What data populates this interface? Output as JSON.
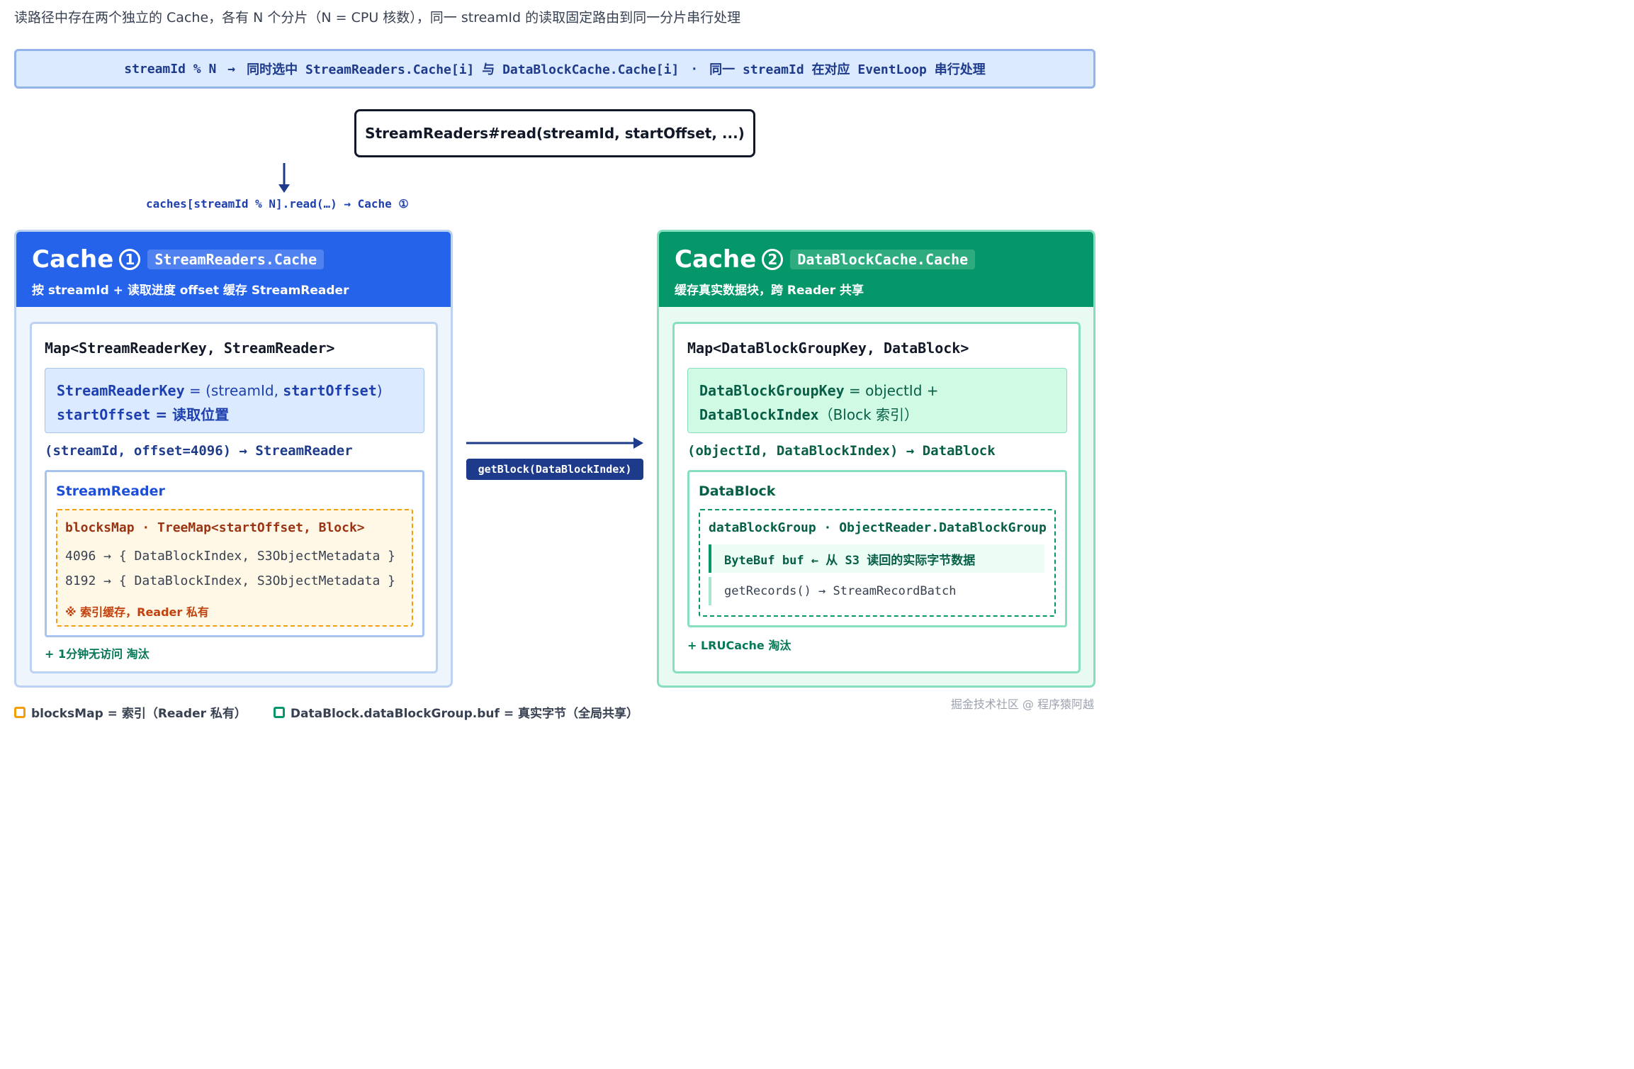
{
  "intro": "读路径中存在两个独立的 Cache，各有 N 个分片（N = CPU 核数），同一 streamId 的读取固定路由到同一分片串行处理",
  "banner": {
    "part1": "streamId % N",
    "arrow": "→",
    "part2": "同时选中 StreamReaders.Cache[i] 与 DataBlockCache.Cache[i]",
    "dot": "·",
    "part3": "同一 streamId 在对应 EventLoop 串行处理"
  },
  "entry": "StreamReaders#read(streamId, startOffset, ...)",
  "route_label": "caches[streamId % N].read(…) → Cache ①",
  "cache1": {
    "title": "Cache",
    "number": "1",
    "tag": "StreamReaders.Cache",
    "subtitle": "按 streamId + 读取进度 offset 缓存 StreamReader",
    "map_title": "Map<StreamReaderKey, StreamReader>",
    "key_line1_code": "StreamReaderKey",
    "key_line1_text": " = (streamId, ",
    "key_line1_code2": "startOffset",
    "key_line1_end": ")",
    "key_line2_code": "startOffset",
    "key_line2_text": " = 读取位置",
    "lookup": "(streamId, offset=4096) → StreamReader",
    "reader_title": "StreamReader",
    "blocks_head": "blocksMap · TreeMap<startOffset, Block>",
    "blocks_rows": [
      "4096 → { DataBlockIndex, S3ObjectMetadata }",
      "8192 → { DataBlockIndex, S3ObjectMetadata }"
    ],
    "blocks_note": "※ 索引缓存，Reader 私有",
    "evict": "+ 1分钟无访问 淘汰"
  },
  "cache2": {
    "title": "Cache",
    "number": "2",
    "tag": "DataBlockCache.Cache",
    "subtitle": "缓存真实数据块，跨 Reader 共享",
    "map_title": "Map<DataBlockGroupKey, DataBlock>",
    "key_line1_code": "DataBlockGroupKey",
    "key_line1_text": " = objectId +",
    "key_line2_code": "DataBlockIndex",
    "key_line2_text": "（Block 索引）",
    "lookup": "(objectId, DataBlockIndex) → DataBlock",
    "block_title": "DataBlock",
    "group_head": "dataBlockGroup · ObjectReader.DataBlockGroup",
    "buf_row": "ByteBuf buf  ← 从 S3 读回的实际字节数据",
    "rec_row": "getRecords() → StreamRecordBatch",
    "evict": "+ LRUCache 淘汰"
  },
  "mid_label": "getBlock(DataBlockIndex)",
  "legend": [
    {
      "label": "blocksMap = 索引（Reader 私有）",
      "color": "#f59e0b"
    },
    {
      "label": "DataBlock.dataBlockGroup.buf = 真实字节（全局共享）",
      "color": "#059669"
    }
  ],
  "watermark": "掘金技术社区 @ 程序猿阿越",
  "colors": {
    "cache1_accent": "#2563eb",
    "cache2_accent": "#059669",
    "banner_bg": "#dbeafe",
    "index_accent": "#f59e0b"
  }
}
